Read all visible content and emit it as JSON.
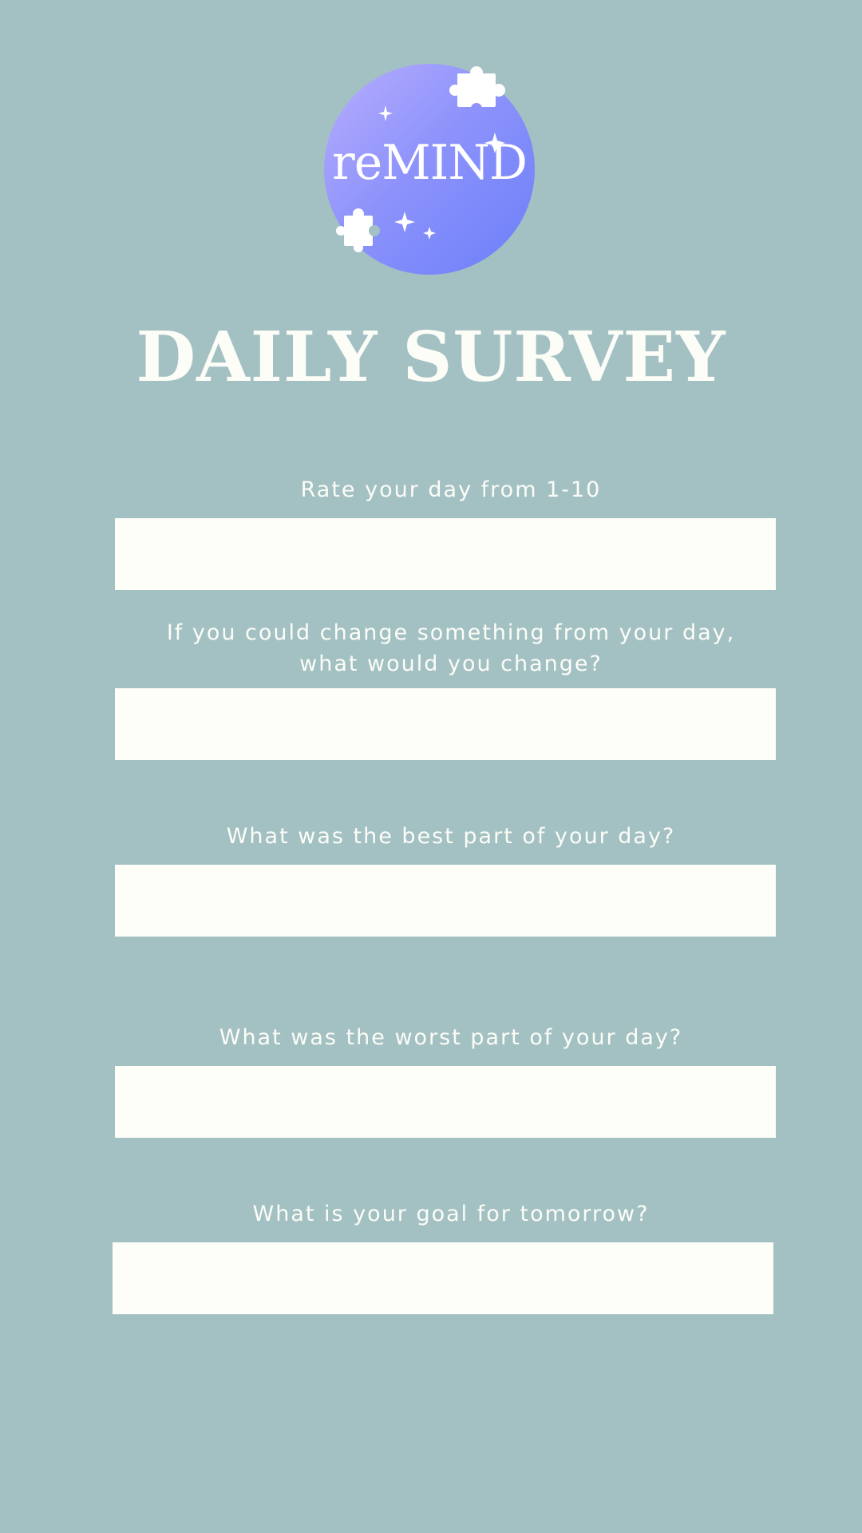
{
  "app": {
    "logo_text": "reMIND",
    "title": "DAILY SURVEY"
  },
  "colors": {
    "background": "#a3c1c3",
    "logo_gradient_start": "#b8aefe",
    "logo_gradient_end": "#6a7ffa",
    "input_background": "#fefef9",
    "text": "#fdfdf7"
  },
  "icons": {
    "logo_decorations": [
      "puzzle-piece-icon",
      "puzzle-piece-icon",
      "sparkle-icon"
    ]
  },
  "survey": {
    "questions": [
      {
        "label": "Rate your day from 1-10",
        "value": "",
        "placeholder": ""
      },
      {
        "label_line1": "If you could change something from your day,",
        "label_line2": "what would you change?",
        "value": "",
        "placeholder": ""
      },
      {
        "label": "What was the best part of your day?",
        "value": "",
        "placeholder": ""
      },
      {
        "label": "What was the worst part of your day?",
        "value": "",
        "placeholder": ""
      },
      {
        "label": "What is your goal for tomorrow?",
        "value": "",
        "placeholder": ""
      }
    ]
  }
}
